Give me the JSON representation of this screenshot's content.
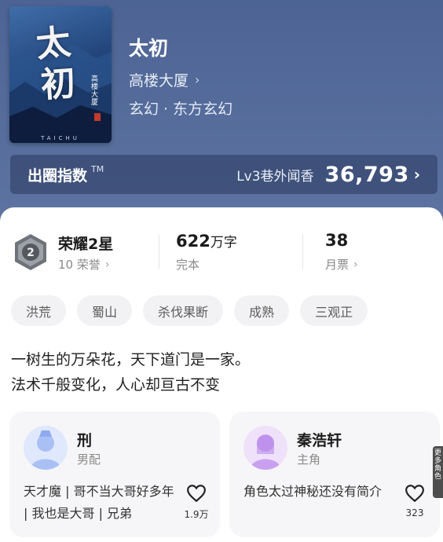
{
  "book": {
    "cover": {
      "title_char_1": "太",
      "title_char_2": "初",
      "author_vertical": "高楼大厦",
      "en_title": "TAICHU"
    },
    "title": "太初",
    "author": "高楼大厦",
    "genre": "玄幻 · 东方玄幻"
  },
  "index": {
    "label": "出圈指数",
    "tm": "TM",
    "level": "Lv3巷外闻香",
    "value": "36,793"
  },
  "stats": {
    "honor": {
      "title": "荣耀2星",
      "sub": "10 荣誉",
      "medal_number": "2"
    },
    "words": {
      "value": "622",
      "unit": "万字",
      "sub": "完本"
    },
    "monthly": {
      "value": "38",
      "sub": "月票"
    }
  },
  "tags": [
    "洪荒",
    "蜀山",
    "杀伐果断",
    "成熟",
    "三观正"
  ],
  "description": [
    "一树生的万朵花，天下道门是一家。",
    "法术千般变化，人心却亘古不变"
  ],
  "characters": [
    {
      "name": "刑",
      "role": "男配",
      "desc": "天才魔 | 哥不当大哥好多年 | 我也是大哥 | 兄弟",
      "likes": "1.9万",
      "avatar_color": "#a9c0f5"
    },
    {
      "name": "秦浩轩",
      "role": "主角",
      "desc": "角色太过神秘还没有简介",
      "likes": "323",
      "avatar_color": "#c9a0f0"
    }
  ],
  "side_tab": "更多角色"
}
